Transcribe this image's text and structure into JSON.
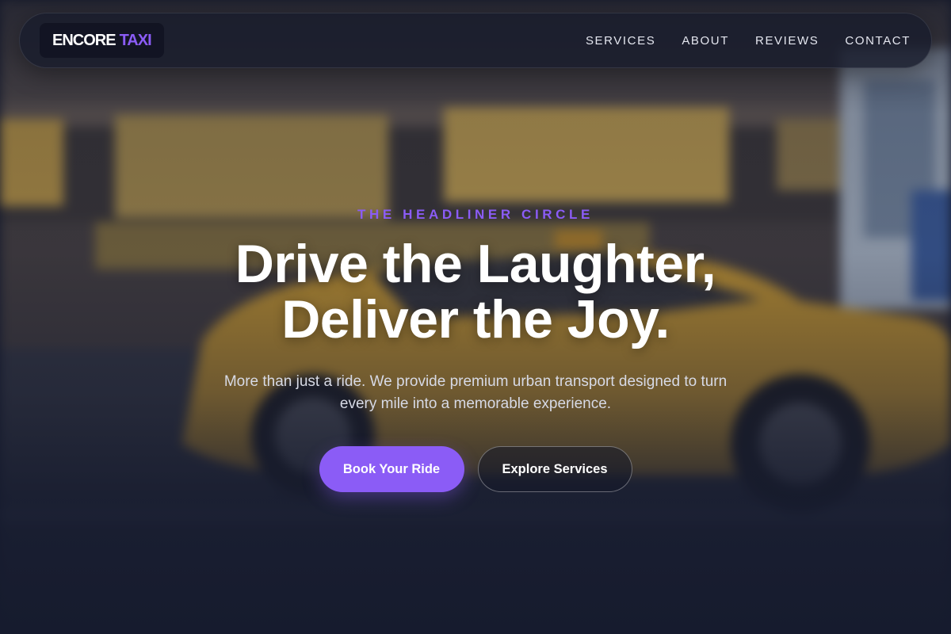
{
  "brand": {
    "name_part1": "ENCORE",
    "name_part2": "TAXI",
    "accent_color": "#8b5cf6"
  },
  "nav": {
    "items": [
      {
        "label": "SERVICES"
      },
      {
        "label": "ABOUT"
      },
      {
        "label": "REVIEWS"
      },
      {
        "label": "CONTACT"
      }
    ]
  },
  "hero": {
    "eyebrow": "THE HEADLINER CIRCLE",
    "headline_line1": "Drive the Laughter,",
    "headline_line2": "Deliver the Joy.",
    "subtitle": "More than just a ride. We provide premium urban transport designed to turn every mile into a memorable experience.",
    "primary_cta": "Book Your Ride",
    "secondary_cta": "Explore Services"
  },
  "colors": {
    "background": "#141a2e",
    "primary_button": "#8b5cf6",
    "text": "#ffffff"
  }
}
